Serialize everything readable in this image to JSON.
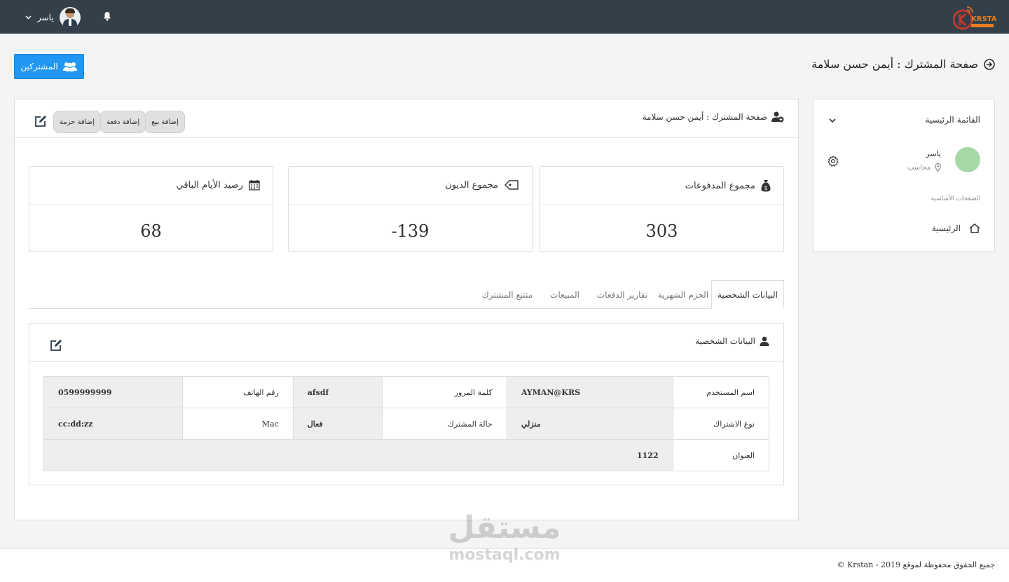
{
  "header": {
    "user_name": "ياسر",
    "logo_text": "KRSTAN"
  },
  "page": {
    "title": "صفحة المشترك : أيمن حسن سلامة",
    "subscribers_button": "المشتركين"
  },
  "panel": {
    "title": "صفحة المشترك : أيمن حسن سلامة",
    "actions": [
      "إضافة حزمة",
      "إضافة دفعة",
      "إضافة بيع"
    ]
  },
  "stats": [
    {
      "label": "مجموع المدفوعات",
      "value": "303"
    },
    {
      "label": "مجموع الديون",
      "value": "-139"
    },
    {
      "label": "رصيد الأيام الباقي",
      "value": "68"
    }
  ],
  "tabs": [
    "البيانات الشخصية",
    "الحزم الشهرية",
    "تقارير الدفعات",
    "المبيعات",
    "متتبع المشترك"
  ],
  "personal": {
    "title": "البيانات الشخصية",
    "rows": [
      [
        {
          "k": "اسم المستخدم",
          "v": "AYMAN@KRS"
        },
        {
          "k": "كلمة المرور",
          "v": "afsdf"
        },
        {
          "k": "رقم الهاتف",
          "v": "0599999999"
        }
      ],
      [
        {
          "k": "نوع الاشتراك",
          "v": "منزلي"
        },
        {
          "k": "حالة المشترك",
          "v": "فعال"
        },
        {
          "k": "Mac",
          "v": "cc:dd:zz"
        }
      ],
      [
        {
          "k": "العنوان",
          "v": "1122"
        }
      ]
    ]
  },
  "sidebar": {
    "menu_title": "القائمة الرئيسية",
    "user_name": "ياسر",
    "user_role": "محاسب",
    "section": "الصفحات الأساسية",
    "home": "الرئيسية"
  },
  "footer": {
    "copyright": "جميع الحقوق محفوظة لموقع Krstan - 2019 ©"
  },
  "watermark": {
    "ar": "مستقل",
    "en": "mostaql.com"
  }
}
